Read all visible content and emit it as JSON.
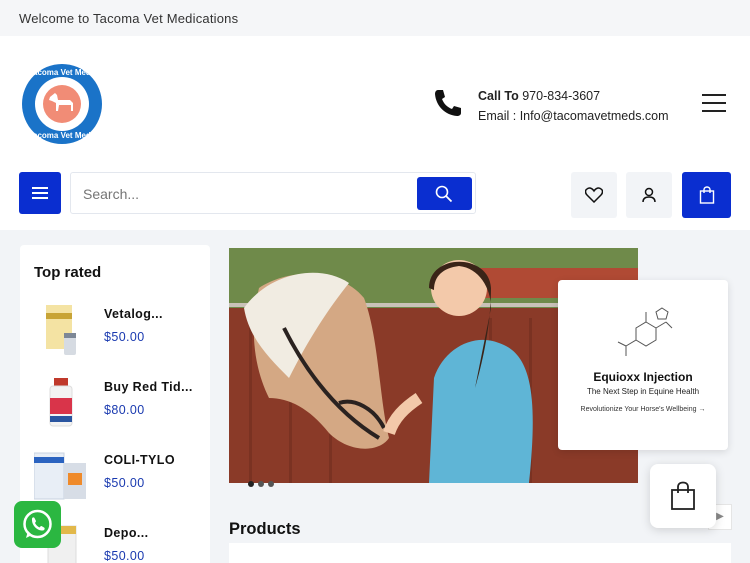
{
  "topbar": {
    "welcome_text": "Welcome to Tacoma Vet Medications"
  },
  "logo": {
    "top_text": "Tacoma Vet Meds",
    "bottom_text": "Tacoma Vet Meds"
  },
  "contact": {
    "call_label": "Call To",
    "phone": "970-834-3607",
    "email_label": "Email :",
    "email": "Info@tacomavetmeds.com"
  },
  "search": {
    "placeholder": "Search..."
  },
  "sidebar": {
    "title": "Top rated",
    "items": [
      {
        "name": "Vetalog...",
        "price": "$50.00"
      },
      {
        "name": "Buy Red Tid...",
        "price": "$80.00"
      },
      {
        "name": "COLI-TYLO",
        "price": "$50.00"
      },
      {
        "name": "Depo...",
        "price": "$50.00"
      }
    ]
  },
  "promo": {
    "title": "Equioxx Injection",
    "subtitle": "The Next Step in Equine Health",
    "link": "Revolutionize Your Horse's Wellbeing →"
  },
  "products": {
    "title": "Products"
  },
  "colors": {
    "primary": "#0a2ed0",
    "price": "#1a3ab0",
    "whatsapp": "#2bb741"
  }
}
